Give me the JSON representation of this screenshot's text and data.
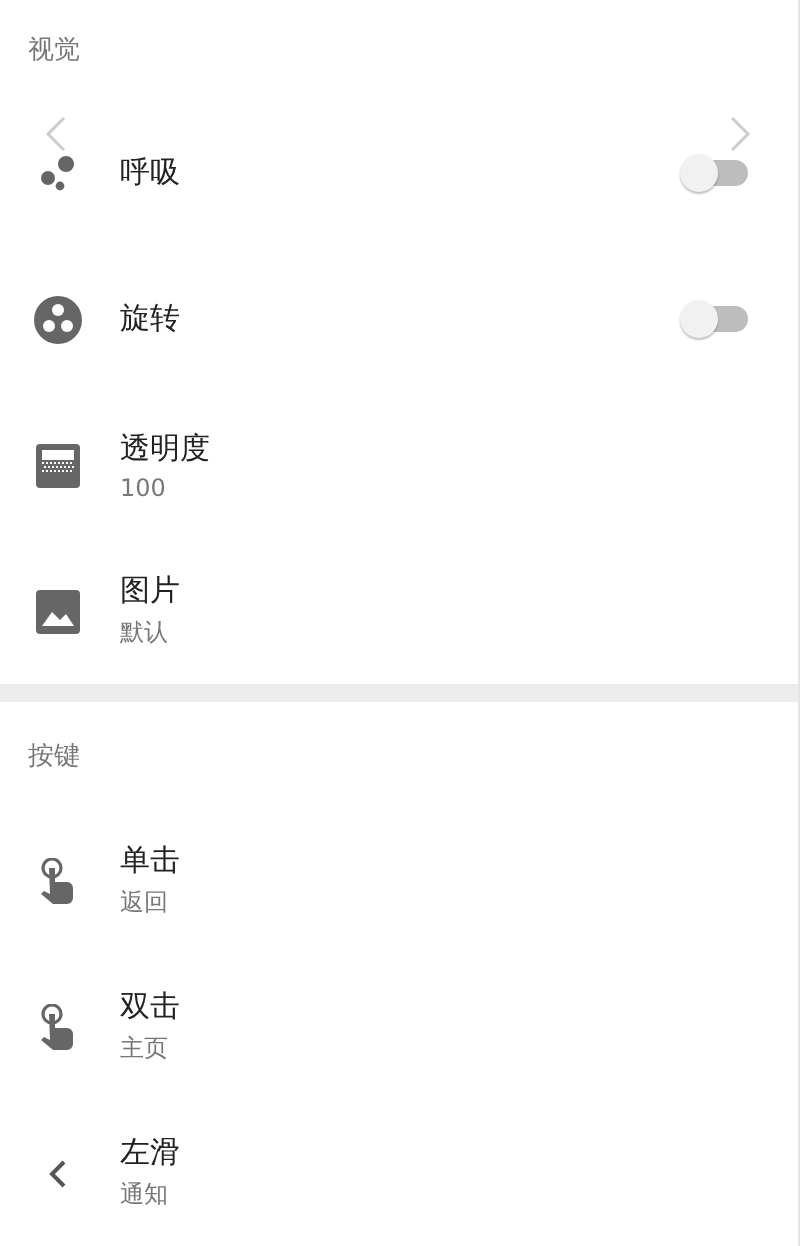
{
  "sections": [
    {
      "title": "视觉",
      "items": [
        {
          "kind": "switch",
          "title": "呼吸",
          "on": false
        },
        {
          "kind": "switch",
          "title": "旋转",
          "on": false
        },
        {
          "kind": "value",
          "title": "透明度",
          "subtitle": "100"
        },
        {
          "kind": "value",
          "title": "图片",
          "subtitle": "默认"
        }
      ]
    },
    {
      "title": "按键",
      "items": [
        {
          "kind": "value",
          "title": "单击",
          "subtitle": "返回"
        },
        {
          "kind": "value",
          "title": "双击",
          "subtitle": "主页"
        },
        {
          "kind": "value",
          "title": "左滑",
          "subtitle": "通知"
        }
      ]
    }
  ]
}
